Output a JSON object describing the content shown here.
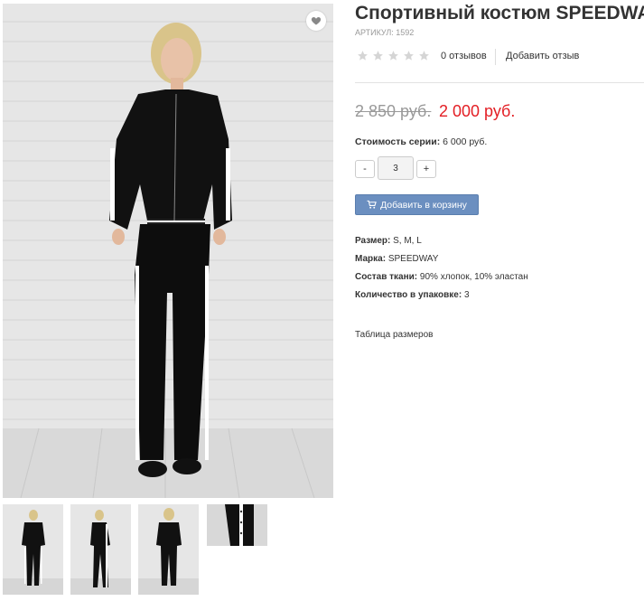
{
  "product": {
    "title": "Спортивный костюм SPEEDWAY",
    "sku_label": "АРТИКУЛ:",
    "sku_value": "1592"
  },
  "rating": {
    "stars_total": 5,
    "stars_filled": 0,
    "reviews_count": "0 отзывов",
    "add_review": "Добавить отзыв"
  },
  "price": {
    "old": "2 850 руб.",
    "new": "2 000 руб.",
    "new_color": "#e31e24"
  },
  "series": {
    "label": "Стоимость серии:",
    "value": "6 000 руб."
  },
  "quantity": {
    "minus": "-",
    "value": "3",
    "plus": "+"
  },
  "cart": {
    "label": "Добавить в корзину",
    "color": "#6b8fc0",
    "icon": "cart-icon"
  },
  "properties": [
    {
      "label": "Размер:",
      "value": "S, M, L"
    },
    {
      "label": "Марка:",
      "value": "SPEEDWAY"
    },
    {
      "label": "Состав ткани:",
      "value": "90% хлопок, 10% эластан"
    },
    {
      "label": "Количество в упаковке:",
      "value": "3"
    }
  ],
  "size_table": "Таблица размеров",
  "icons": {
    "favorite": "heart-icon",
    "star": "star-icon"
  }
}
